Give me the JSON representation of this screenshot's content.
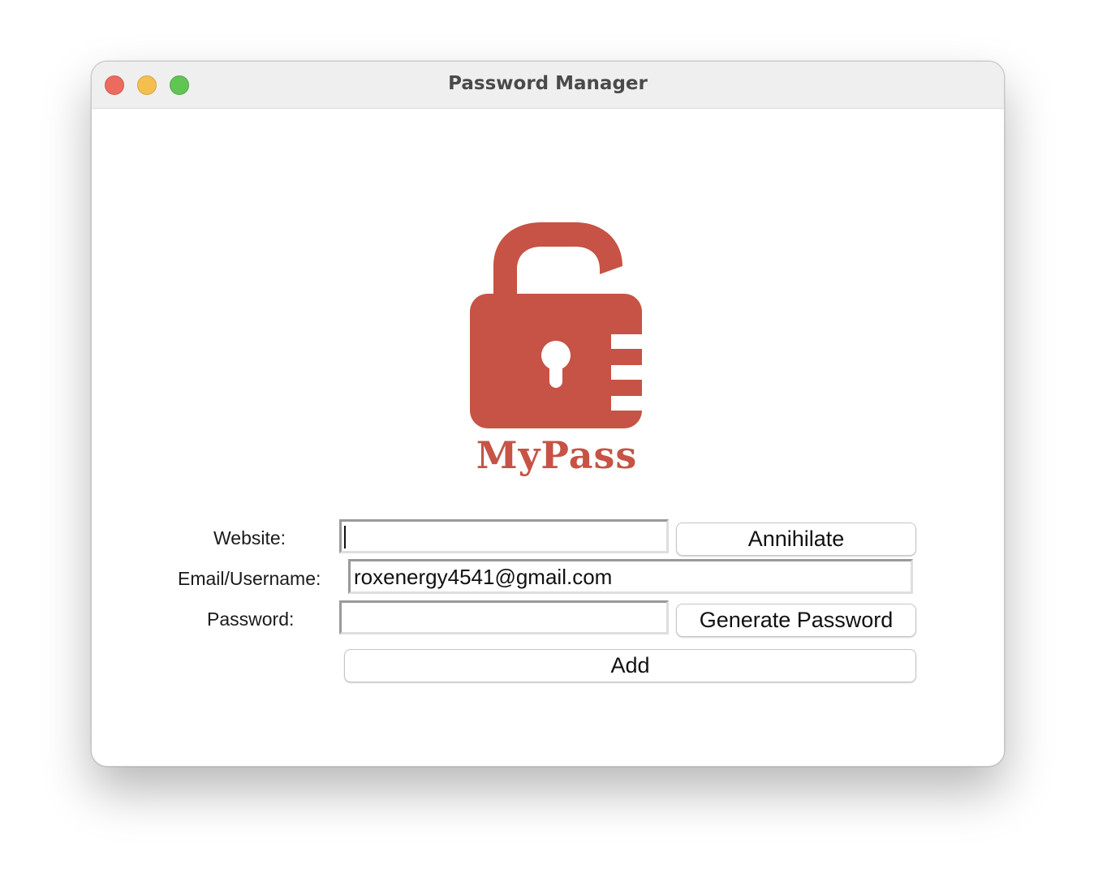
{
  "window": {
    "title": "Password Manager"
  },
  "logo": {
    "icon": "open-padlock-icon",
    "text": "MyPass",
    "color": "#c65345"
  },
  "form": {
    "website_label": "Website:",
    "website_value": "",
    "email_label": "Email/Username:",
    "email_value": "roxenergy4541@gmail.com",
    "password_label": "Password:",
    "password_value": ""
  },
  "buttons": {
    "annihilate": "Annihilate",
    "generate_password": "Generate Password",
    "add": "Add"
  },
  "colors": {
    "close": "#ec6a5e",
    "minimize": "#f4bf4f",
    "maximize": "#61c554"
  }
}
